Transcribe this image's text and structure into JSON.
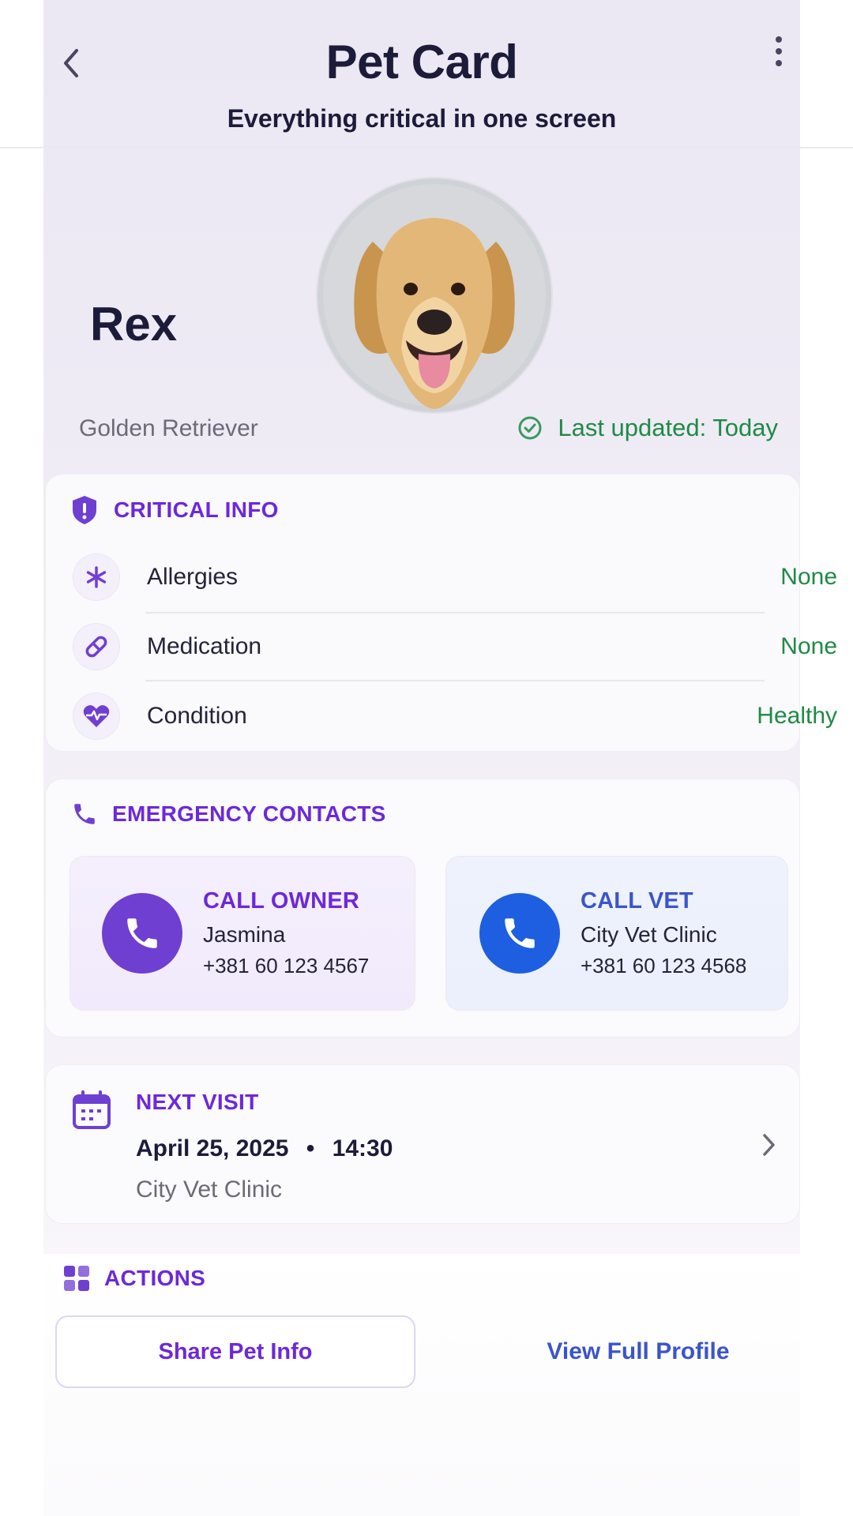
{
  "header": {
    "title": "Pet Card",
    "subtitle": "Everything critical in one screen",
    "back_icon": "chevron-left-icon",
    "menu_icon": "more-vertical-icon"
  },
  "pet": {
    "name": "Rex",
    "breed": "Golden Retriever",
    "last_updated": "Last updated: Today",
    "photo": "golden-retriever-photo"
  },
  "critical_info": {
    "title": "CRITICAL INFO",
    "items": [
      {
        "label": "Allergies",
        "value": "None",
        "icon": "asterisk-icon"
      },
      {
        "label": "Medication",
        "value": "None",
        "icon": "pill-icon"
      },
      {
        "label": "Condition",
        "value": "Healthy",
        "icon": "heart-pulse-icon"
      }
    ]
  },
  "emergency": {
    "title": "EMERGENCY CONTACTS",
    "owner": {
      "title": "CALL OWNER",
      "name": "Jasmina",
      "phone": "+381 60 123 4567"
    },
    "vet": {
      "title": "CALL VET",
      "name": "City Vet Clinic",
      "phone": "+381 60 123 4568"
    }
  },
  "next_visit": {
    "title": "NEXT VISIT",
    "date": "April 25, 2025",
    "separator": "•",
    "time": "14:30",
    "place": "City Vet Clinic"
  },
  "actions": {
    "title": "ACTIONS",
    "share_label": "Share Pet Info",
    "profile_label": "View Full Profile"
  },
  "colors": {
    "accent_purple": "#6d28d9",
    "accent_blue": "#1d5fe0",
    "status_green": "#1f8a44",
    "text_dark": "#1c1b3a"
  }
}
